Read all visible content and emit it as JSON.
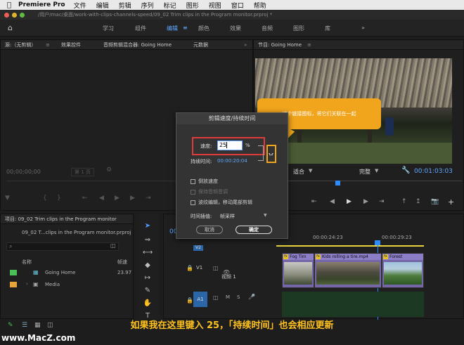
{
  "menubar": {
    "app": "Premiere Pro",
    "items": [
      "文件",
      "编辑",
      "剪辑",
      "序列",
      "标记",
      "图形",
      "视图",
      "窗口",
      "帮助"
    ]
  },
  "titlebar": {
    "path": "/用户/mac/桌面/work-with-clips-channels-speed/09_02 Trim clips in the Program monitor.prproj *"
  },
  "workspace": {
    "tabs": [
      "学习",
      "组件",
      "编辑",
      "颜色",
      "效果",
      "音频",
      "图形",
      "库"
    ],
    "active": "编辑"
  },
  "source_panel": {
    "tabs": [
      "源:（无剪辑）",
      "效果控件",
      "音频剪辑混合器: Going Home",
      "元数据"
    ],
    "timecode": "00;00;00;00",
    "page": "第 1 页"
  },
  "program_panel": {
    "title": "节目: Going Home",
    "fit": "适合",
    "quality": "完整",
    "timecode": "00:01:03:03"
  },
  "dialog": {
    "title": "剪辑速度/持续时间",
    "speed_label": "速度:",
    "speed_value": "25",
    "speed_unit": "%",
    "duration_label": "持续时间:",
    "duration_value": "00:00:20:04",
    "reverse": "倒放速度",
    "maintain_pitch": "保持音频音调",
    "ripple": "波纹编辑，移动尾部剪辑",
    "interp_label": "时间插值:",
    "interp_value": "帧采样",
    "cancel": "取消",
    "ok": "确定"
  },
  "callout": {
    "text": "这个链接图标，将它们关联在一起"
  },
  "project_panel": {
    "title": "项目: 09_02 Trim clips in the Program monitor",
    "file": "09_02 T...clips in the Program monitor.prproj",
    "col_name": "名称",
    "col_rate": "帧速",
    "items": [
      {
        "name": "Going Home",
        "rate": "23.97",
        "color": "#4cbf58"
      },
      {
        "name": "Media",
        "rate": "",
        "color": "#e8a23a"
      }
    ]
  },
  "timeline": {
    "timecode_a": "00:00:24:23",
    "timecode_b": "00:00:29:23",
    "video_track": "V1",
    "video_label": "视频 1",
    "audio_track": "A1",
    "partial_tc": "00",
    "clips": [
      {
        "name": "Fog Tim"
      },
      {
        "name": "Kids rolling a tire.mp4"
      },
      {
        "name": "Forest"
      }
    ]
  },
  "caption": {
    "text": "如果我在这里键入 25，「持续时间」也会相应更新"
  },
  "watermark": {
    "text": "www.MacZ.com"
  }
}
